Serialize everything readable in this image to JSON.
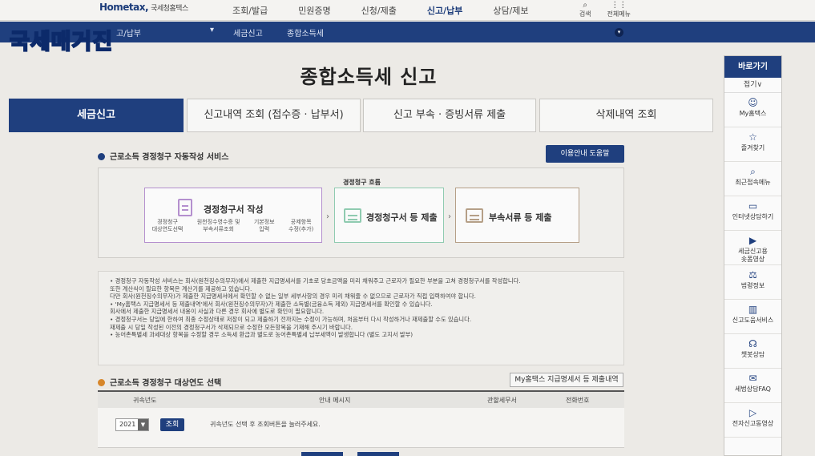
{
  "header": {
    "logo": "Hometax,",
    "logo_sub": "국세청홈택스",
    "menu": [
      "조회/발급",
      "민원증명",
      "신청/제출",
      "신고/납부",
      "상담/제보"
    ],
    "util": [
      {
        "icon": "search-icon",
        "label": "검색"
      },
      {
        "icon": "menu-icon",
        "label": "전체메뉴"
      }
    ]
  },
  "subnav": {
    "crumb1": "고/납부",
    "crumb2": "세금신고",
    "crumb3": "종합소득세"
  },
  "overlay": {
    "title": "국세매거진"
  },
  "page": {
    "title": "종합소득세 신고"
  },
  "tabs": [
    "세금신고",
    "신고내역 조회 (접수증 · 납부서)",
    "신고 부속 · 증빙서류 제출",
    "삭제내역 조회"
  ],
  "section1": {
    "title": "근로소득 경정청구 자동작성 서비스",
    "help_button": "이용안내 도움말",
    "flow_label": "경정청구 흐름",
    "card1": {
      "title": "경정청구서 작성",
      "subs": [
        "경정청구\n대상연도선택",
        "원천징수영수증 및\n부속서류조회",
        "기본정보\n입력",
        "공제항목\n수정(추가)"
      ]
    },
    "card2": {
      "title": "경정청구서 등 제출"
    },
    "card3": {
      "title": "부속서류 등 제출"
    },
    "arrow": "›"
  },
  "info_lines": [
    "• 경정청구 자동작성 서비스는 회사(원천징수의무자)에서 제출한 지급명세서를 기초로 당초금액을 미리 채워주고 근로자가 필요한 부분을 고쳐 경정청구서를 작성합니다.",
    "  또한 계산식이 필요한 항목은 계산기를 제공하고 있습니다.",
    "  다만 회사(원천징수의무자)가 제출한 지급명세서에서 확인할 수 없는 일부 세부사항의 경우 미리 채워줄 수 없으므로 근로자가 직접 입력하여야 합니다.",
    "• 'My홈택스 지급명세서 등 제출내역'에서 회사(원천징수의무자)가 제출한 소득별(금융소득 제외) 지급명세서를 확인할 수 있습니다.",
    "  회사에서 제출한 지급명세서 내용이 사실과 다른 경우 회사에 별도로 확인이 필요합니다.",
    "• 경정청구서는 당일에 한하여 최종 수정상태로 저장이 되고 제출하기 전까지는 수정이 가능하며, 처음부터 다시 작성하거나 재제출할 수도 있습니다.",
    "  재제출 시 당일 작성된 이전의 경정청구서가 삭제되므로 수정한 모든항목을 기재해 주시기 바랍니다.",
    "• 농어촌특별세 과세대상 항목을 수정할 경우 소득세 환급과 별도로 농어촌특별세 납부세액이 발생합니다 (별도 고지서 발부)"
  ],
  "section2": {
    "title": "근로소득 경정청구 대상연도 선택",
    "my_button": "My홈택스 지급명세서 등 제출내역",
    "table": {
      "headers": [
        "귀속년도",
        "안내 메시지",
        "관할세무서",
        "전화번호"
      ],
      "row": {
        "year": "2021",
        "query_button": "조회",
        "message": "귀속년도 선택 후 조회버튼을 눌러주세요."
      }
    }
  },
  "quick": {
    "title": "바로가기",
    "fold": "접기∨",
    "items": [
      {
        "icon": "person-icon",
        "label": "My홈택스"
      },
      {
        "icon": "star-icon",
        "label": "즐겨찾기"
      },
      {
        "icon": "recent-menu-icon",
        "label": "최근접속메뉴"
      },
      {
        "icon": "monitor-icon",
        "label": "인터넷상담하기"
      },
      {
        "icon": "video-icon",
        "label": "세금신고용\n숏폼영상"
      },
      {
        "icon": "gavel-icon",
        "label": "법령정보"
      },
      {
        "icon": "book-icon",
        "label": "신고도움서비스"
      },
      {
        "icon": "headset-icon",
        "label": "챗봇상담"
      },
      {
        "icon": "chat-icon",
        "label": "세법상담FAQ"
      },
      {
        "icon": "play-icon",
        "label": "전자신고동영상"
      }
    ]
  },
  "colors": {
    "navy": "#1f3f7e",
    "orange": "#d7872b",
    "card1": "#b48fce",
    "card2": "#8fcbb0",
    "card3": "#b59f87"
  }
}
